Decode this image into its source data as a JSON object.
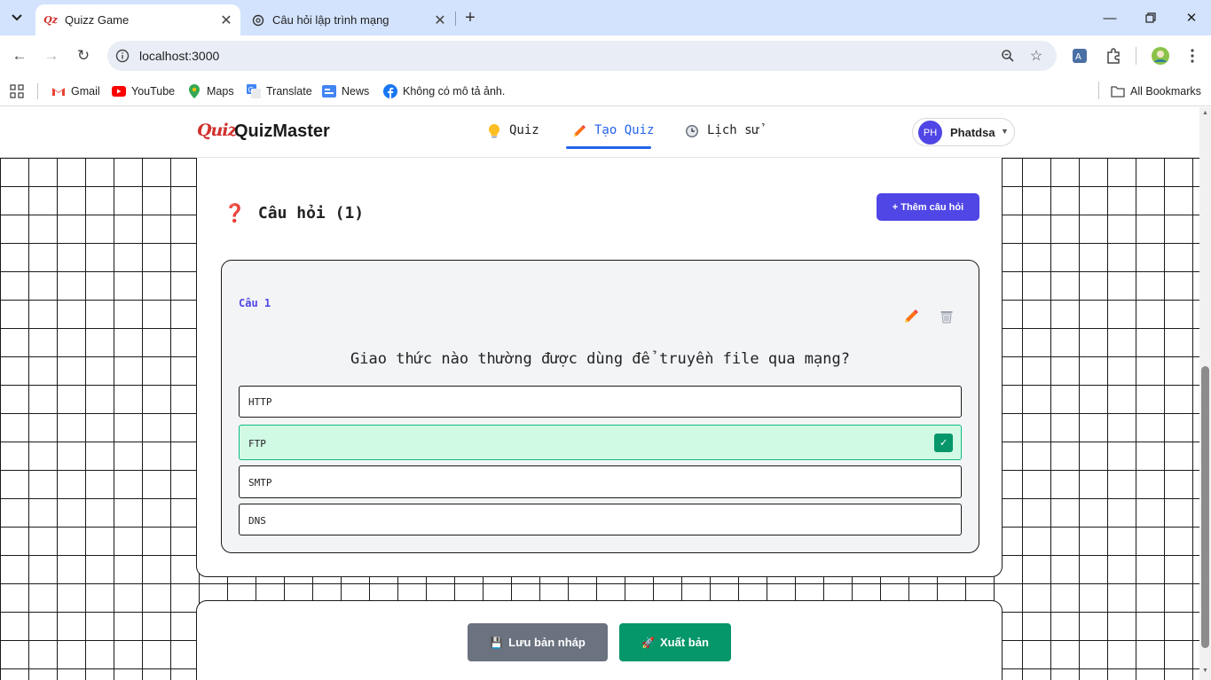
{
  "browser": {
    "tabs": [
      {
        "title": "Quizz Game",
        "active": true,
        "favicon": "quizz-logo"
      },
      {
        "title": "Câu hỏi lập trình mạng",
        "active": false,
        "favicon": "openai-icon"
      }
    ],
    "url": "localhost:3000",
    "bookmarks": [
      {
        "label": "Gmail",
        "icon": "gmail-icon"
      },
      {
        "label": "YouTube",
        "icon": "youtube-icon"
      },
      {
        "label": "Maps",
        "icon": "maps-icon"
      },
      {
        "label": "Translate",
        "icon": "translate-icon"
      },
      {
        "label": "News",
        "icon": "news-icon"
      },
      {
        "label": "Không có mô tả ảnh.",
        "icon": "facebook-icon"
      }
    ],
    "all_bookmarks": "All Bookmarks"
  },
  "app": {
    "logo_mark": "Quiz",
    "logo_text": "QuizMaster",
    "nav": [
      {
        "label": "Quiz",
        "icon": "lightbulb-icon",
        "active": false
      },
      {
        "label": "Tạo Quiz",
        "icon": "pencil-icon",
        "active": true
      },
      {
        "label": "Lịch sử",
        "icon": "clock-icon",
        "active": false
      }
    ],
    "user": {
      "initials": "PH",
      "name": "Phatdsa"
    }
  },
  "questions_section": {
    "title": "Câu hỏi (1)",
    "add_button": "+ Thêm câu hỏi",
    "items": [
      {
        "number_label": "Câu 1",
        "text": "Giao thức nào thường được dùng để truyền file qua mạng?",
        "options": [
          {
            "text": "HTTP",
            "correct": false
          },
          {
            "text": "FTP",
            "correct": true
          },
          {
            "text": "SMTP",
            "correct": false
          },
          {
            "text": "DNS",
            "correct": false
          }
        ]
      }
    ]
  },
  "actions": {
    "save_draft": "Lưu bản nháp",
    "publish": "Xuất bản"
  },
  "colors": {
    "accent": "#4f46e5",
    "active_nav": "#2563eb",
    "correct_bg": "#d1fae5",
    "correct_check": "#059669",
    "draft_button": "#6b7280"
  }
}
